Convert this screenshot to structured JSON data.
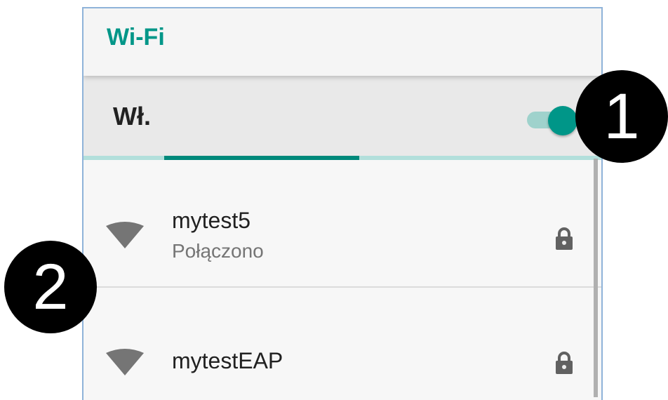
{
  "header": {
    "title": "Wi-Fi"
  },
  "switch": {
    "label": "Wł.",
    "state": "on",
    "accent": "#009688"
  },
  "networks": [
    {
      "ssid": "mytest5",
      "status": "Połączono",
      "secured": true,
      "icon": "wifi-signal-icon"
    },
    {
      "ssid": "mytestEAP",
      "status": "",
      "secured": true,
      "icon": "wifi-signal-icon"
    }
  ],
  "callouts": [
    {
      "label": "1"
    },
    {
      "label": "2"
    }
  ]
}
